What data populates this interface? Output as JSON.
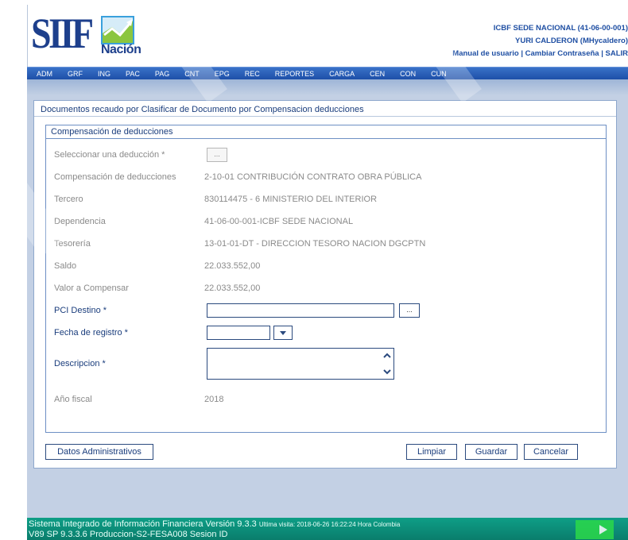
{
  "header": {
    "logo": {
      "text": "SIIF",
      "sub": "Nación"
    },
    "entity": "ICBF SEDE NACIONAL (41-06-00-001)",
    "user": "YURI CALDERON (MHycaldero)",
    "links": [
      "Manual de usuario",
      "Cambiar Contraseña",
      "SALIR"
    ],
    "link_sep": " | "
  },
  "menu": [
    "ADM",
    "GRF",
    "ING",
    "PAC",
    "PAG",
    "CNT",
    "EPG",
    "REC",
    "REPORTES",
    "CARGA",
    "CEN",
    "CON",
    "CUN"
  ],
  "panel": {
    "title": "Documentos recaudo por Clasificar de Documento por Compensacion deducciones",
    "section_title": "Compensación de deducciones",
    "fields": {
      "deduccion_label": "Seleccionar una deducción *",
      "deduccion_btn": "...",
      "compensacion_label": "Compensación de deducciones",
      "compensacion_value": "2-10-01 CONTRIBUCIÓN CONTRATO OBRA PÚBLICA",
      "tercero_label": "Tercero",
      "tercero_value": "830114475 - 6 MINISTERIO DEL INTERIOR",
      "dependencia_label": "Dependencia",
      "dependencia_value": "41-06-00-001-ICBF SEDE NACIONAL",
      "tesoreria_label": "Tesorería",
      "tesoreria_value": "13-01-01-DT - DIRECCION TESORO NACION DGCPTN",
      "saldo_label": "Saldo",
      "saldo_value": "22.033.552,00",
      "valor_label": "Valor a Compensar",
      "valor_value": "22.033.552,00",
      "pci_label": "PCI Destino *",
      "pci_value": "",
      "pci_btn": "...",
      "fecha_label": "Fecha de registro *",
      "fecha_value": "",
      "descripcion_label": "Descripcion *",
      "descripcion_value": "",
      "anio_label": "Año fiscal",
      "anio_value": "2018"
    }
  },
  "buttons": {
    "datos": "Datos Administrativos",
    "limpiar": "Limpiar",
    "guardar": "Guardar",
    "cancelar": "Cancelar"
  },
  "footer": {
    "line1": "Sistema Integrado de Información Financiera Versión 9.3.3",
    "visit": "Ultima visita: 2018-06-26 16:22:24 Hora Colombia",
    "line2": "V89 SP 9.3.3.6 Produccion-S2-FESA008 Sesion ID"
  },
  "colors": {
    "brand_blue": "#1d3f8c",
    "menu_blue": "#1d4fa8",
    "required_label": "#1a3d7c",
    "footer_teal": "#0a7d6c",
    "logo_green": "#8bc63f",
    "logo_sky": "#3aa0dc"
  }
}
